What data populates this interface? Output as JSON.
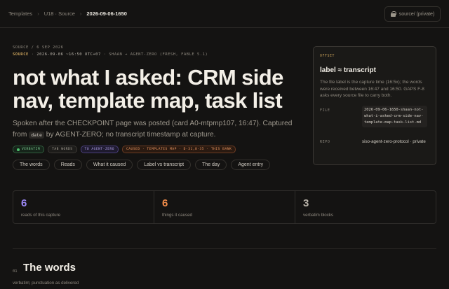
{
  "breadcrumb": {
    "items": [
      "Templates",
      "U18 · Source",
      "2026-09-06-1650"
    ]
  },
  "privacy": {
    "label": "source/ (private)",
    "icon": "lock-icon"
  },
  "hero": {
    "kicker": "SOURCE / 6 SEP 2026",
    "meta_source": "SOURCE",
    "meta_datetime": "2026-09-06 ~16:50 UTC+07",
    "meta_rest": "SHAAN → AGENT-ZERO (FRESH, FABLE 5.1)",
    "title": "not what I asked: CRM side nav, template map, task list",
    "desc_before": "Spoken after the CHECKPOINT page was posted (card A0-mtpmp107, 16:47). Captured from",
    "desc_code": "date",
    "desc_after": "by AGENT-ZERO; no transcript timestamp at capture."
  },
  "tags": [
    {
      "label": "VERBATIM",
      "style": "green"
    },
    {
      "label": "TAB WORDS",
      "style": "gray"
    },
    {
      "label": "TO AGENT-ZERO",
      "style": "purple"
    },
    {
      "label": "CAUSED · TEMPLATES MAP · D-31,8-35 · THIS BANK",
      "style": "orange"
    }
  ],
  "nav": [
    "The words",
    "Reads",
    "What it caused",
    "Label vs transcript",
    "The day",
    "Agent entry"
  ],
  "side_card": {
    "label": "OFFSET",
    "heading": "label ≈ transcript",
    "text": "The file label is the capture time (16:5x); the words were received between 16:47 and 16:50. GAPS F-8 asks every source file to carry both.",
    "file_key": "FILE",
    "file_value": "2026-09-06-1650-shaan-not-what-i-asked-crm-side-nav-template-map-task-list.md",
    "repo_key": "REPO",
    "repo_value": "siso-agent-zero-protocol · private"
  },
  "stats": [
    {
      "value": "6",
      "label": "reads of this capture",
      "color": "#9b87f5"
    },
    {
      "value": "6",
      "label": "things it caused",
      "color": "#f08c4a"
    },
    {
      "value": "3",
      "label": "verbatim blocks",
      "color": "#b9b3a9"
    }
  ],
  "section": {
    "number": "01",
    "title": "The words",
    "subtitle": "verbatim; punctuation as delivered"
  }
}
